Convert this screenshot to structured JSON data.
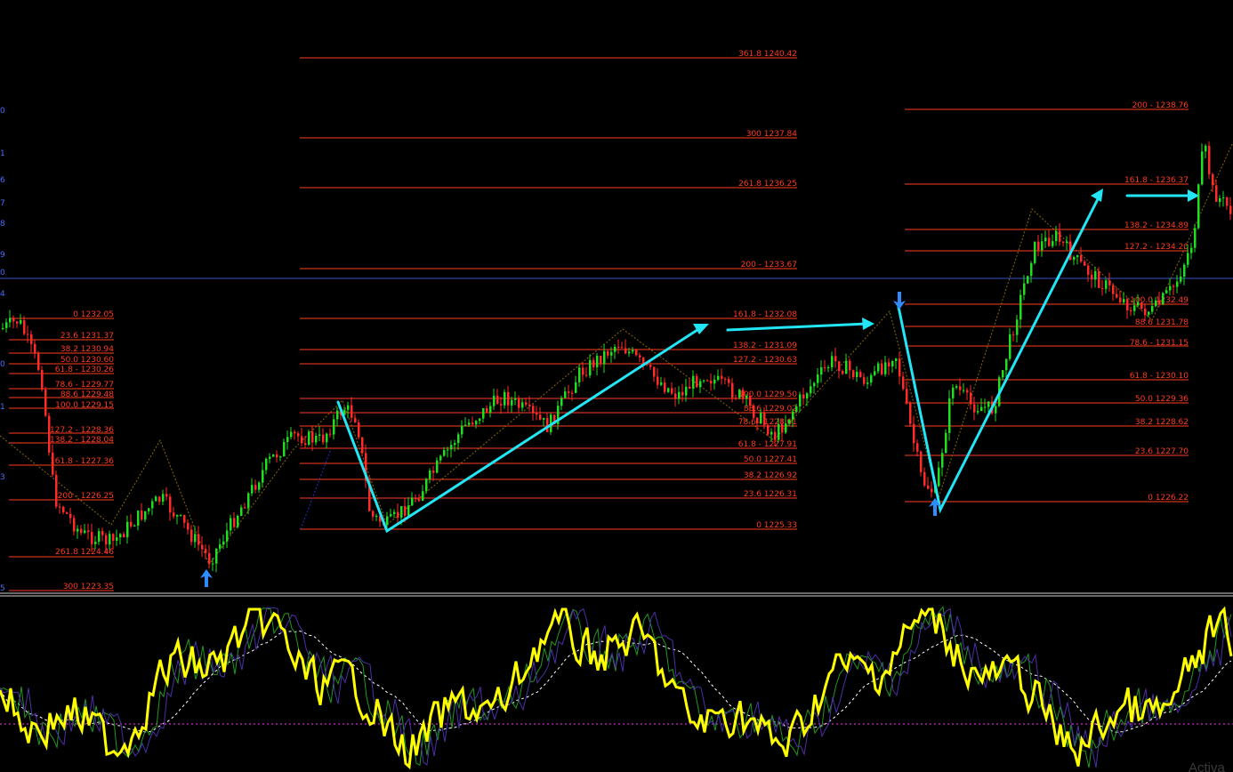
{
  "colors": {
    "background": "#000000",
    "fib_line": "#ff3b1f",
    "fib_text": "#ff3b1f",
    "bull_candle": "#22dd22",
    "bear_candle": "#ff2a2a",
    "arrow_annotation": "#22e5f5",
    "signal_arrow": "#2f8cff",
    "horizontal_level": "#3b4fc9",
    "oscillator_main": "#ffff00",
    "oscillator_signal": "#ffffff",
    "oscillator_level": "#ff33ff",
    "zigzag": "#8b6a00"
  },
  "left_edge_labels": [
    "0",
    "1",
    "6",
    "7",
    "8",
    "9",
    "0",
    "4",
    "0",
    "1",
    "3",
    "5"
  ],
  "fib_groups": [
    {
      "name": "group-1",
      "levels": [
        {
          "label": "0 1232.05"
        },
        {
          "label": "23.6 1231.37"
        },
        {
          "label": "38.2 1230.94"
        },
        {
          "label": "50.0 1230.60"
        },
        {
          "label": "61.8 - 1230.26"
        },
        {
          "label": "78.6 - 1229.77"
        },
        {
          "label": "88.6 1229.48"
        },
        {
          "label": "100.0 1229.15"
        },
        {
          "label": "127.2 - 1228.36"
        },
        {
          "label": "138.2 - 1228.04"
        },
        {
          "label": "161.8 -  1227.36"
        },
        {
          "label": "200 - 1226.25"
        },
        {
          "label": "261.8 1224.46"
        },
        {
          "label": "300 1223.35"
        }
      ]
    },
    {
      "name": "group-2",
      "levels": [
        {
          "label": "361.8 1240.42"
        },
        {
          "label": "300 1237.84"
        },
        {
          "label": "261.8 1236.25"
        },
        {
          "label": "200 - 1233.67"
        },
        {
          "label": "161.8 -  1232.08"
        },
        {
          "label": "138.2 - 1231.09"
        },
        {
          "label": "127.2 - 1230.63"
        },
        {
          "label": "100.0 1229.50"
        },
        {
          "label": "88.6 1229.02"
        },
        {
          "label": "78.6 - 1228.61"
        },
        {
          "label": "61.8 - 1227.91"
        },
        {
          "label": "50.0 1227.41"
        },
        {
          "label": "38.2 1226.92"
        },
        {
          "label": "23.6 1226.31"
        },
        {
          "label": "0 1225.33"
        }
      ]
    },
    {
      "name": "group-3",
      "levels": [
        {
          "label": "200 - 1238.76"
        },
        {
          "label": "161.8 -  1236.37"
        },
        {
          "label": "138.2 - 1234.89"
        },
        {
          "label": "127.2 - 1234.20"
        },
        {
          "label": "100.0 1232.49"
        },
        {
          "label": "88.6 1231.78"
        },
        {
          "label": "78.6 - 1231.15"
        },
        {
          "label": "61.8 - 1230.10"
        },
        {
          "label": "50.0 1229.36"
        },
        {
          "label": "38.2 1228.62"
        },
        {
          "label": "23.6 1227.70"
        },
        {
          "label": "0 1226.22"
        }
      ]
    }
  ],
  "watermark": "Activa"
}
